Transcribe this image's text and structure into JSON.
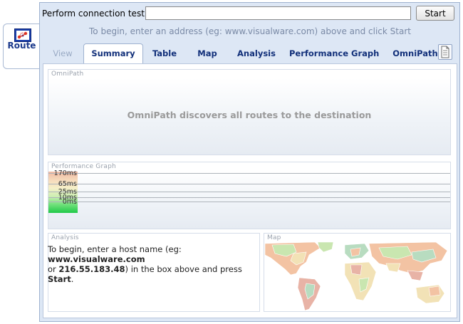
{
  "side_tab": {
    "label": "Route",
    "icon": "route-icon"
  },
  "connection": {
    "label": "Perform connection test to",
    "input_value": "",
    "start_label": "Start",
    "hint": "To begin, enter an address (eg: www.visualware.com) above and click Start"
  },
  "tabs": [
    {
      "label": "View",
      "state": "disabled"
    },
    {
      "label": "Summary",
      "state": "active"
    },
    {
      "label": "Table",
      "state": "normal"
    },
    {
      "label": "Map",
      "state": "normal"
    },
    {
      "label": "Analysis",
      "state": "normal"
    },
    {
      "label": "Performance Graph",
      "state": "normal"
    },
    {
      "label": "OmniPath",
      "state": "normal"
    }
  ],
  "toolbar_icon": "document-icon",
  "panels": {
    "omnipath": {
      "title": "OmniPath",
      "message": "OmniPath discovers all routes to the destination"
    },
    "performance": {
      "title": "Performance Graph",
      "levels": [
        "170ms",
        "65ms",
        "25ms",
        "10ms",
        "0ms"
      ]
    },
    "analysis": {
      "title": "Analysis",
      "text_1": "To begin, enter a host name (eg: ",
      "host": "www.visualware.com",
      "text_2": "or ",
      "ip": "216.55.183.48",
      "text_3": ") in the box above and press ",
      "start_word": "Start",
      "text_4": "."
    },
    "map": {
      "title": "Map"
    }
  },
  "colors": {
    "frame_bg": "#dde7f5",
    "tab_text": "#12307a",
    "hint_text": "#7a8aa6",
    "map_land_colors": [
      "#f3c3a3",
      "#c9e6b0",
      "#f2e2b6",
      "#e8b3a6",
      "#b8dcc0"
    ]
  }
}
